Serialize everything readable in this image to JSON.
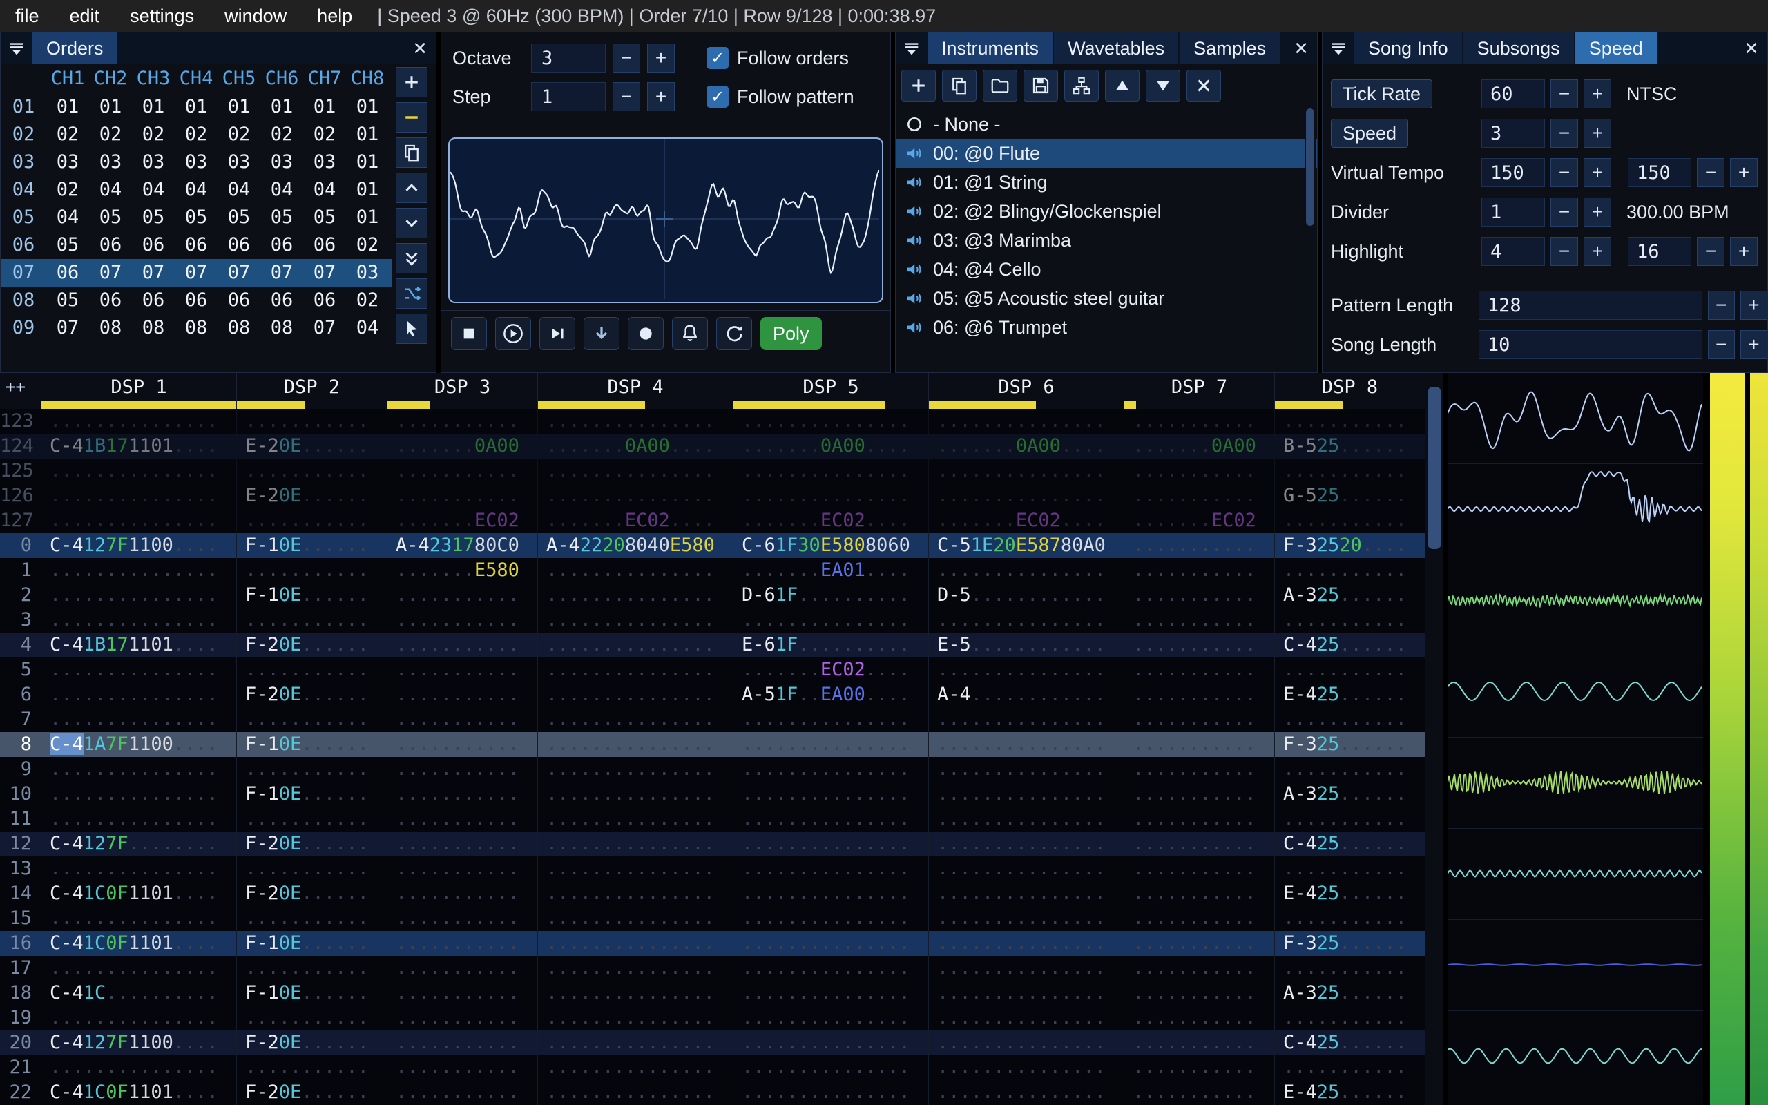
{
  "menu": {
    "items": [
      "file",
      "edit",
      "settings",
      "window",
      "help"
    ],
    "status": "| Speed 3 @ 60Hz (300 BPM) | Order 7/10 | Row 9/128 | 0:00:38.97"
  },
  "orders": {
    "title": "Orders",
    "channels": [
      "CH1",
      "CH2",
      "CH3",
      "CH4",
      "CH5",
      "CH6",
      "CH7",
      "CH8"
    ],
    "rows": [
      {
        "num": "01",
        "vals": [
          "01",
          "01",
          "01",
          "01",
          "01",
          "01",
          "01",
          "01"
        ]
      },
      {
        "num": "02",
        "vals": [
          "02",
          "02",
          "02",
          "02",
          "02",
          "02",
          "02",
          "01"
        ]
      },
      {
        "num": "03",
        "vals": [
          "03",
          "03",
          "03",
          "03",
          "03",
          "03",
          "03",
          "01"
        ]
      },
      {
        "num": "04",
        "vals": [
          "02",
          "04",
          "04",
          "04",
          "04",
          "04",
          "04",
          "01"
        ]
      },
      {
        "num": "05",
        "vals": [
          "04",
          "05",
          "05",
          "05",
          "05",
          "05",
          "05",
          "01"
        ]
      },
      {
        "num": "06",
        "vals": [
          "05",
          "06",
          "06",
          "06",
          "06",
          "06",
          "06",
          "02"
        ]
      },
      {
        "num": "07",
        "vals": [
          "06",
          "07",
          "07",
          "07",
          "07",
          "07",
          "07",
          "03"
        ],
        "current": true
      },
      {
        "num": "08",
        "vals": [
          "05",
          "06",
          "06",
          "06",
          "06",
          "06",
          "06",
          "02"
        ]
      },
      {
        "num": "09",
        "vals": [
          "07",
          "08",
          "08",
          "08",
          "08",
          "08",
          "07",
          "04"
        ]
      }
    ]
  },
  "edit_controls": {
    "octave_label": "Octave",
    "octave_value": "3",
    "step_label": "Step",
    "step_value": "1",
    "follow_orders_label": "Follow orders",
    "follow_pattern_label": "Follow pattern",
    "poly_label": "Poly"
  },
  "instruments": {
    "tabs": [
      "Instruments",
      "Wavetables",
      "Samples"
    ],
    "active_tab": "Instruments",
    "none_label": "- None -",
    "items": [
      "00: @0 Flute",
      "01: @1 String",
      "02: @2 Blingy/Glockenspiel",
      "03: @3 Marimba",
      "04: @4 Cello",
      "05: @5 Acoustic steel guitar",
      "06: @6 Trumpet"
    ],
    "selected_item": "00: @0 Flute"
  },
  "song_info": {
    "tabs": [
      "Song Info",
      "Subsongs",
      "Speed"
    ],
    "active_tab": "Speed",
    "tick_rate_label": "Tick Rate",
    "tick_rate": "60",
    "tick_rate_mode": "NTSC",
    "speed_label": "Speed",
    "speed": "3",
    "virtual_tempo_label": "Virtual Tempo",
    "virtual_tempo_num": "150",
    "virtual_tempo_den": "150",
    "divider_label": "Divider",
    "divider": "1",
    "bpm": "300.00 BPM",
    "highlight_label": "Highlight",
    "highlight_first": "4",
    "highlight_second": "16",
    "pattern_length_label": "Pattern Length",
    "pattern_length": "128",
    "song_length_label": "Song Length",
    "song_length": "10"
  },
  "pattern": {
    "corner": "++",
    "channels": [
      {
        "name": "DSP 1",
        "fx": 2,
        "bar": 1.0
      },
      {
        "name": "DSP 2",
        "fx": 1,
        "bar": 0.45
      },
      {
        "name": "DSP 3",
        "fx": 1,
        "bar": 0.28
      },
      {
        "name": "DSP 4",
        "fx": 2,
        "bar": 0.55
      },
      {
        "name": "DSP 5",
        "fx": 2,
        "bar": 0.78
      },
      {
        "name": "DSP 6",
        "fx": 2,
        "bar": 0.55
      },
      {
        "name": "DSP 7",
        "fx": 1,
        "bar": 0.08
      },
      {
        "name": "DSP 8",
        "fx": 1,
        "bar": 0.45
      }
    ],
    "rows": [
      {
        "n": "123",
        "cls": "prev",
        "cells": []
      },
      {
        "n": "124",
        "cls": "prev hl1",
        "cells": [
          [
            "C-4",
            "1B",
            "17",
            "1101",
            ""
          ],
          [
            "E-2",
            "0E",
            "",
            ""
          ],
          [
            "",
            "",
            "",
            "0A00"
          ],
          [
            "",
            "",
            "",
            "0A00",
            ""
          ],
          [
            "",
            "",
            "",
            "0A00",
            ""
          ],
          [
            "",
            "",
            "",
            "0A00",
            ""
          ],
          [
            "",
            "",
            "",
            "0A00"
          ],
          [
            "B-5",
            "25",
            "",
            ""
          ]
        ]
      },
      {
        "n": "125",
        "cls": "prev",
        "cells": []
      },
      {
        "n": "126",
        "cls": "prev",
        "cells": [
          [],
          [
            "E-2",
            "0E",
            "",
            ""
          ],
          [],
          [],
          [],
          [],
          [],
          [
            "G-5",
            "25",
            "",
            ""
          ]
        ]
      },
      {
        "n": "127",
        "cls": "prev",
        "cells": [
          [],
          [],
          [
            "",
            "",
            "",
            "EC02"
          ],
          [
            "",
            "",
            "",
            "EC02",
            ""
          ],
          [
            "",
            "",
            "",
            "EC02",
            ""
          ],
          [
            "",
            "",
            "",
            "EC02",
            ""
          ],
          [
            "",
            "",
            "",
            "EC02"
          ],
          []
        ]
      },
      {
        "n": "0",
        "cls": "hl2",
        "cells": [
          [
            "C-4",
            "12",
            "7F",
            "1100",
            ""
          ],
          [
            "F-1",
            "0E",
            "",
            ""
          ],
          [
            "A-4",
            "23",
            "17",
            "80C0"
          ],
          [
            "A-4",
            "22",
            "20",
            "8040",
            "E580"
          ],
          [
            "C-6",
            "1F",
            "30",
            "E580",
            "8060"
          ],
          [
            "C-5",
            "1E",
            "20",
            "E587",
            "80A0"
          ],
          [],
          [
            "F-3",
            "25",
            "20",
            ""
          ]
        ]
      },
      {
        "n": "1",
        "cls": "",
        "cells": [
          [],
          [],
          [
            "",
            "",
            "",
            "E580"
          ],
          [],
          [
            "",
            "",
            "",
            "EA01",
            ""
          ],
          [],
          [],
          []
        ]
      },
      {
        "n": "2",
        "cls": "",
        "cells": [
          [],
          [
            "F-1",
            "0E",
            "",
            ""
          ],
          [],
          [],
          [
            "D-6",
            "1F",
            "",
            "",
            ""
          ],
          [
            "D-5",
            "",
            "",
            "",
            ""
          ],
          [],
          [
            "A-3",
            "25",
            "",
            ""
          ]
        ]
      },
      {
        "n": "3",
        "cls": "",
        "cells": []
      },
      {
        "n": "4",
        "cls": "hl1",
        "cells": [
          [
            "C-4",
            "1B",
            "17",
            "1101",
            ""
          ],
          [
            "F-2",
            "0E",
            "",
            ""
          ],
          [],
          [],
          [
            "E-6",
            "1F",
            "",
            "",
            ""
          ],
          [
            "E-5",
            "",
            "",
            "",
            ""
          ],
          [],
          [
            "C-4",
            "25",
            "",
            ""
          ]
        ]
      },
      {
        "n": "5",
        "cls": "",
        "cells": [
          [],
          [],
          [],
          [],
          [
            "",
            "",
            "",
            "EC02",
            ""
          ],
          [],
          [],
          []
        ]
      },
      {
        "n": "6",
        "cls": "",
        "cells": [
          [],
          [
            "F-2",
            "0E",
            "",
            ""
          ],
          [],
          [],
          [
            "A-5",
            "1F",
            "",
            "EA00",
            ""
          ],
          [
            "A-4",
            "",
            "",
            "",
            ""
          ],
          [],
          [
            "E-4",
            "25",
            "",
            ""
          ]
        ]
      },
      {
        "n": "7",
        "cls": "",
        "cells": []
      },
      {
        "n": "8",
        "cls": "current",
        "cursor": true,
        "cells": [
          [
            "C-4",
            "1A",
            "7F",
            "1100",
            ""
          ],
          [
            "F-1",
            "0E",
            "",
            ""
          ],
          [],
          [],
          [],
          [],
          [],
          [
            "F-3",
            "25",
            "",
            ""
          ]
        ]
      },
      {
        "n": "9",
        "cls": "",
        "cells": []
      },
      {
        "n": "10",
        "cls": "",
        "cells": [
          [],
          [
            "F-1",
            "0E",
            "",
            ""
          ],
          [],
          [],
          [],
          [],
          [],
          [
            "A-3",
            "25",
            "",
            ""
          ]
        ]
      },
      {
        "n": "11",
        "cls": "",
        "cells": []
      },
      {
        "n": "12",
        "cls": "hl1",
        "cells": [
          [
            "C-4",
            "12",
            "7F",
            "",
            ""
          ],
          [
            "F-2",
            "0E",
            "",
            ""
          ],
          [],
          [],
          [],
          [],
          [],
          [
            "C-4",
            "25",
            "",
            ""
          ]
        ]
      },
      {
        "n": "13",
        "cls": "",
        "cells": []
      },
      {
        "n": "14",
        "cls": "",
        "cells": [
          [
            "C-4",
            "1C",
            "0F",
            "1101",
            ""
          ],
          [
            "F-2",
            "0E",
            "",
            ""
          ],
          [],
          [],
          [],
          [],
          [],
          [
            "E-4",
            "25",
            "",
            ""
          ]
        ]
      },
      {
        "n": "15",
        "cls": "",
        "cells": []
      },
      {
        "n": "16",
        "cls": "hl2",
        "cells": [
          [
            "C-4",
            "1C",
            "0F",
            "1101",
            ""
          ],
          [
            "F-1",
            "0E",
            "",
            ""
          ],
          [],
          [],
          [],
          [],
          [],
          [
            "F-3",
            "25",
            "",
            ""
          ]
        ]
      },
      {
        "n": "17",
        "cls": "",
        "cells": []
      },
      {
        "n": "18",
        "cls": "",
        "cells": [
          [
            "C-4",
            "1C",
            "",
            "",
            ""
          ],
          [
            "F-1",
            "0E",
            "",
            ""
          ],
          [],
          [],
          [],
          [],
          [],
          [
            "A-3",
            "25",
            "",
            ""
          ]
        ]
      },
      {
        "n": "19",
        "cls": "",
        "cells": []
      },
      {
        "n": "20",
        "cls": "hl1",
        "cells": [
          [
            "C-4",
            "12",
            "7F",
            "1100",
            ""
          ],
          [
            "F-2",
            "0E",
            "",
            ""
          ],
          [],
          [],
          [],
          [],
          [],
          [
            "C-4",
            "25",
            "",
            ""
          ]
        ]
      },
      {
        "n": "21",
        "cls": "",
        "cells": []
      },
      {
        "n": "22",
        "cls": "",
        "cells": [
          [
            "C-4",
            "1C",
            "0F",
            "1101",
            ""
          ],
          [
            "F-2",
            "0E",
            "",
            ""
          ],
          [],
          [],
          [],
          [],
          [],
          [
            "E-4",
            "25",
            "",
            ""
          ]
        ]
      }
    ]
  }
}
